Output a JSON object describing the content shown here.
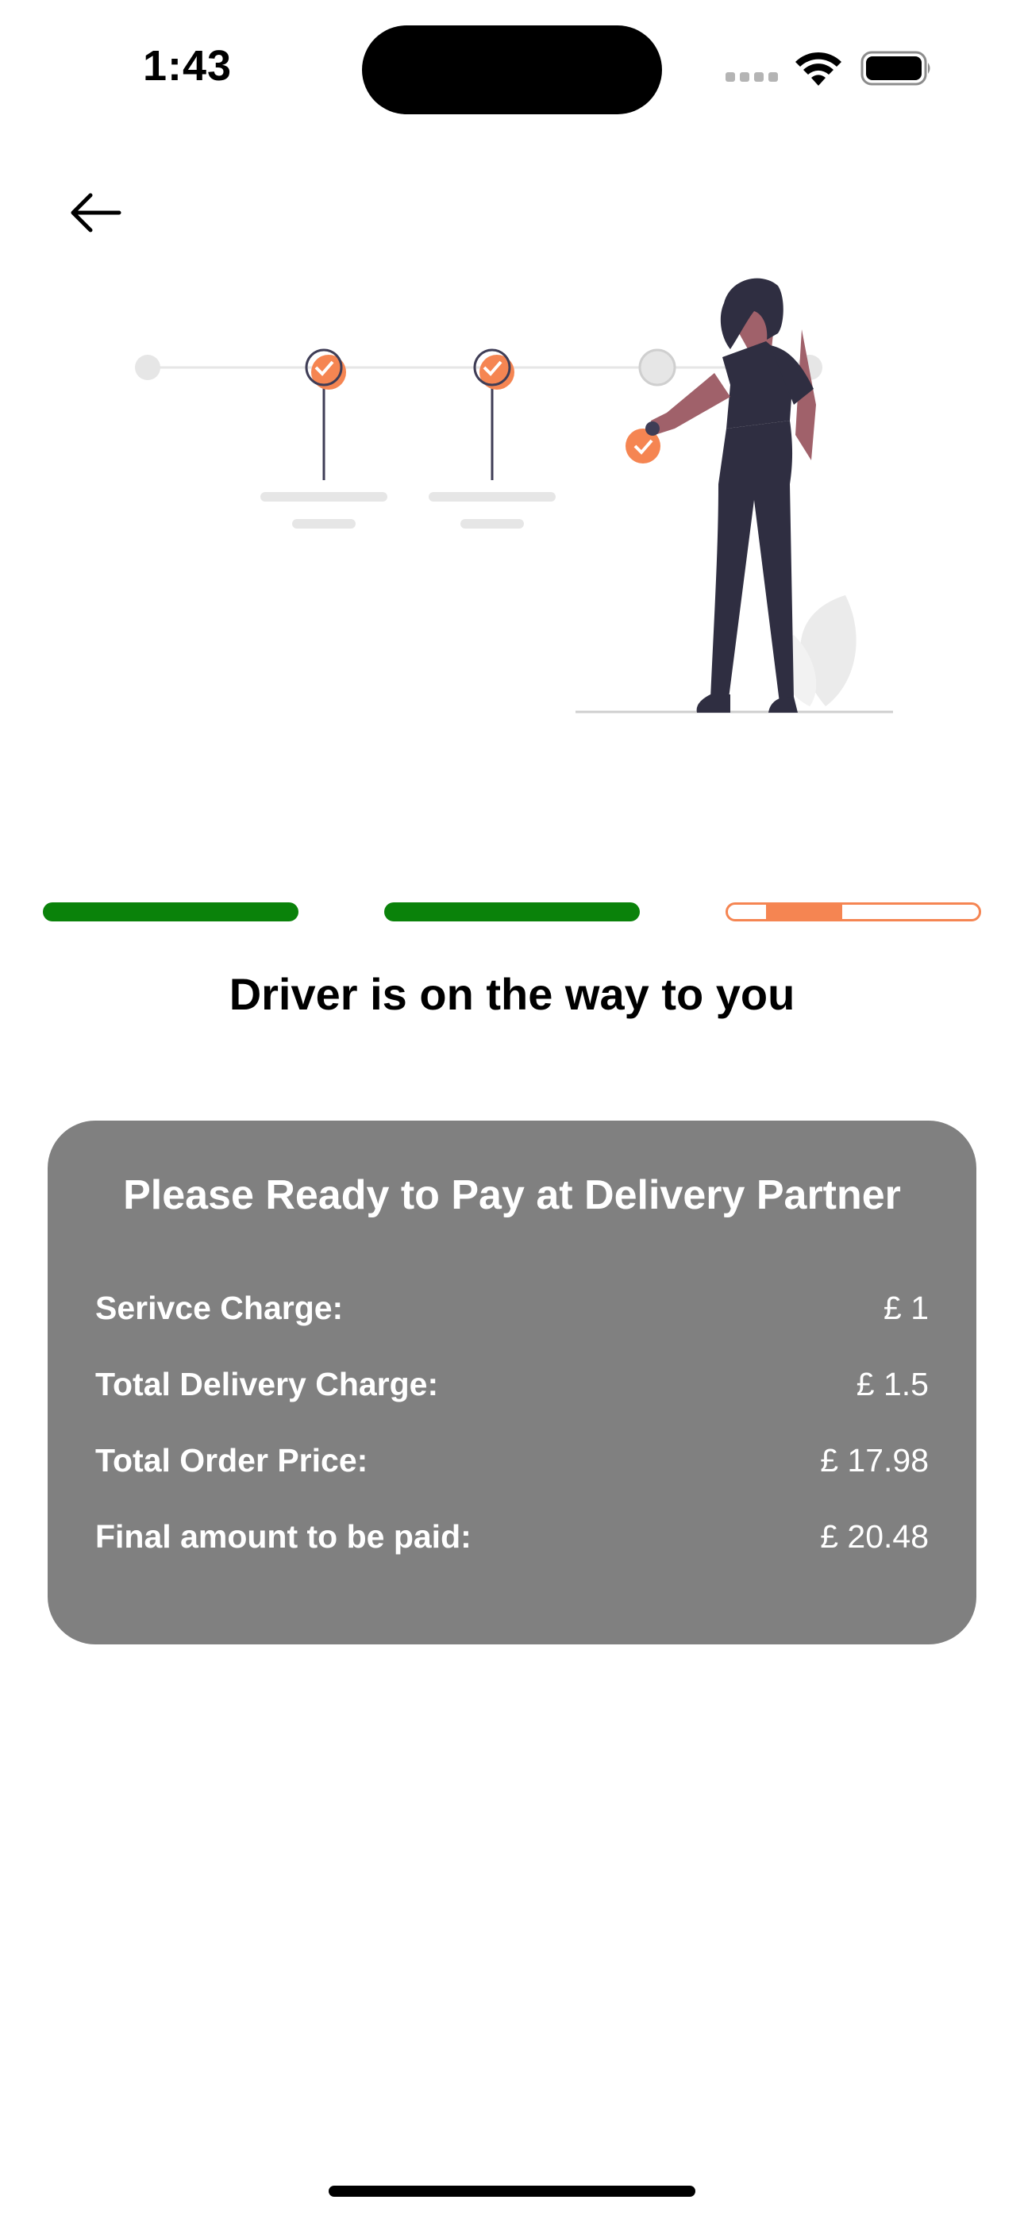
{
  "status_bar": {
    "time": "1:43"
  },
  "header": {
    "back_icon": "arrow-left-icon"
  },
  "progress": {
    "steps_total": 3,
    "steps_completed": 2,
    "current_step_fill": 0.3,
    "colors": {
      "done": "#0a820a",
      "current": "#f58552"
    }
  },
  "status": {
    "title": "Driver is on the way to you"
  },
  "payment": {
    "title": "Please Ready to Pay at Delivery Partner",
    "rows": [
      {
        "label": "Serivce Charge:",
        "value": "£ 1"
      },
      {
        "label": "Total Delivery Charge:",
        "value": "£ 1.5"
      },
      {
        "label": "Total Order Price:",
        "value": "£ 17.98"
      },
      {
        "label": "Final amount to be paid:",
        "value": "£ 20.48"
      }
    ],
    "card_color": "#808080"
  }
}
